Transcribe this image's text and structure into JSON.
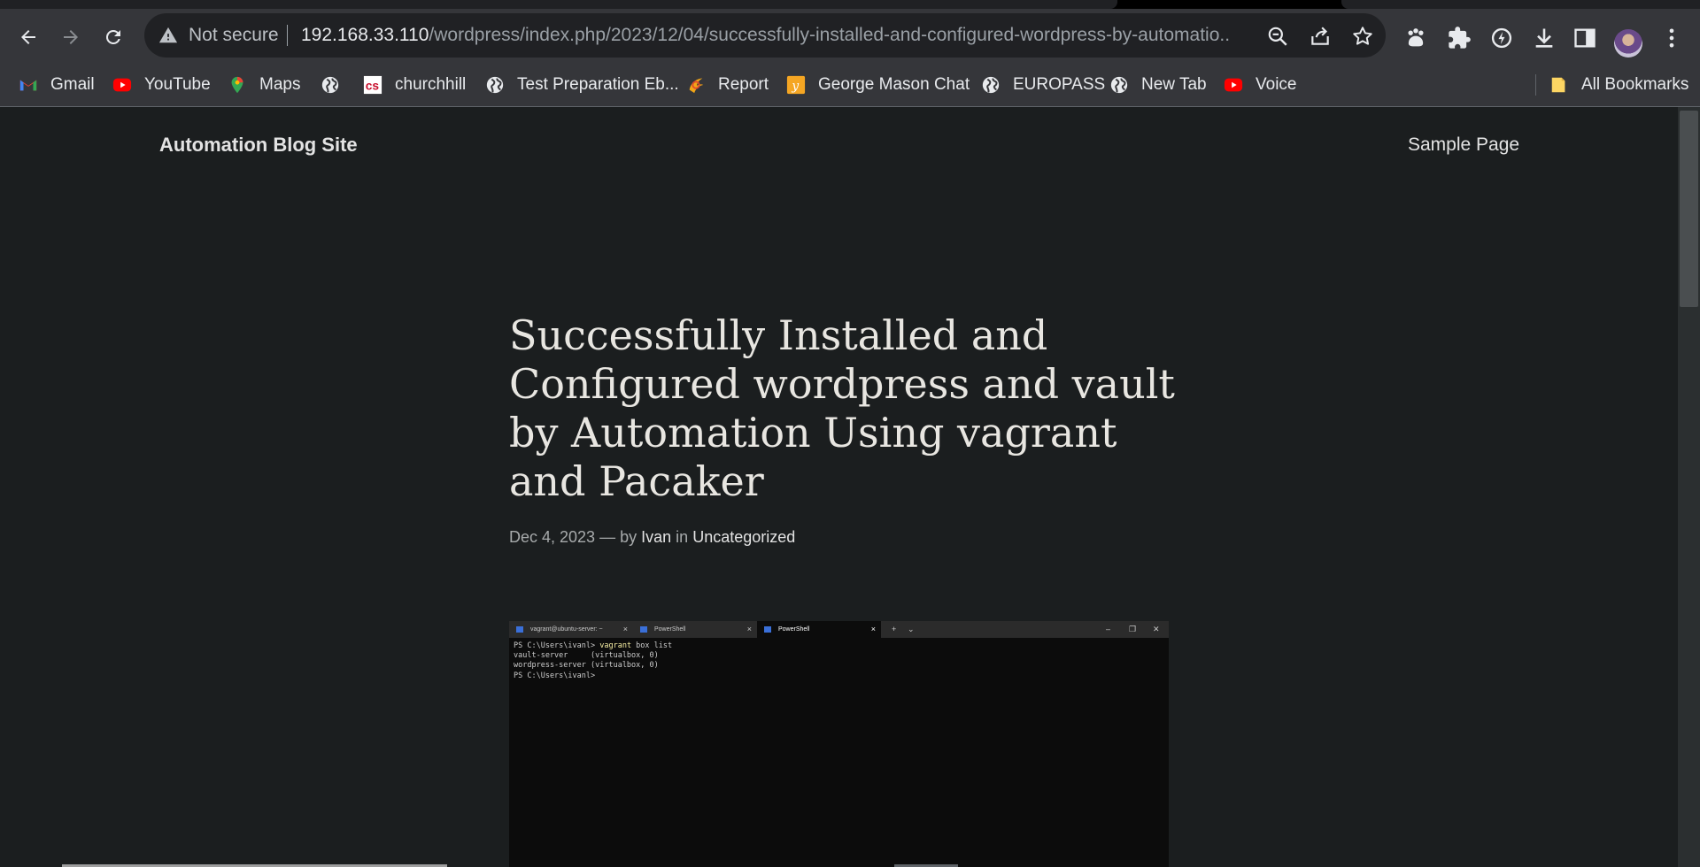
{
  "browser": {
    "security_label": "Not secure",
    "url_host": "192.168.33.110",
    "url_path": "/wordpress/index.php/2023/12/04/successfully-installed-and-configured-wordpress-by-automatio...",
    "bookmarks": [
      {
        "label": "Gmail",
        "icon": "gmail-icon"
      },
      {
        "label": "YouTube",
        "icon": "youtube-icon"
      },
      {
        "label": "Maps",
        "icon": "maps-icon"
      },
      {
        "label": "",
        "icon": "globe-icon"
      },
      {
        "label": "churchhill",
        "icon": "churchhill-icon"
      },
      {
        "label": "Test Preparation Eb...",
        "icon": "globe-icon"
      },
      {
        "label": "Report",
        "icon": "report-icon"
      },
      {
        "label": "George Mason Chat",
        "icon": "yellow-app-icon"
      },
      {
        "label": "EUROPASS",
        "icon": "globe-icon"
      },
      {
        "label": "New Tab",
        "icon": "globe-icon"
      },
      {
        "label": "Voice",
        "icon": "youtube-icon"
      }
    ],
    "all_bookmarks_label": "All Bookmarks"
  },
  "site": {
    "title": "Automation Blog Site",
    "nav_link": "Sample Page"
  },
  "post": {
    "title": "Successfully Installed and Configured wordpress and vault by Automation Using vagrant and Pacaker",
    "date": "Dec 4, 2023",
    "dash_by": "— by",
    "author": "Ivan",
    "in_label": "in",
    "category": "Uncategorized"
  },
  "terminal": {
    "tabs": [
      "vagrant@ubuntu-server: ~",
      "PowerShell",
      "PowerShell"
    ],
    "line1_prompt": "PS C:\\Users\\ivanl> ",
    "line1_cmd": "vagrant",
    "line1_rest": " box list",
    "line2": "vault-server     (virtualbox, 0)",
    "line3": "wordpress-server (virtualbox, 0)",
    "line4": "PS C:\\Users\\ivanl> "
  },
  "colors": {
    "page_bg": "#1b1e1f",
    "chrome_bg": "#35363a",
    "omnibox_bg": "#202124",
    "text": "#e3e3e3"
  }
}
